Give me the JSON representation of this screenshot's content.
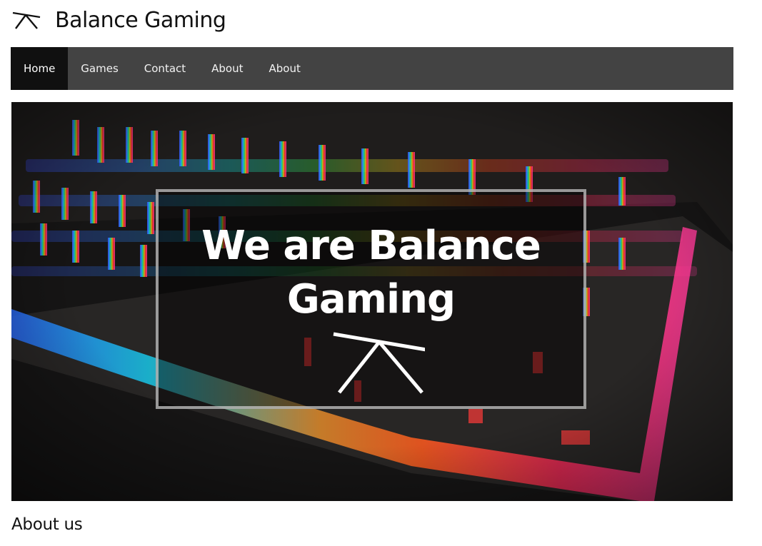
{
  "header": {
    "logo_icon": "balance-scale-icon",
    "title": "Balance Gaming"
  },
  "nav": {
    "items": [
      {
        "label": "Home",
        "active": true
      },
      {
        "label": "Games",
        "active": false
      },
      {
        "label": "Contact",
        "active": false
      },
      {
        "label": "About",
        "active": false
      },
      {
        "label": "About",
        "active": false
      }
    ]
  },
  "hero": {
    "title_line1": "We are Balance",
    "title_line2": "Gaming",
    "emblem_icon": "balance-scale-icon",
    "background": "rgb-keyboard-photo"
  },
  "about": {
    "heading": "About us"
  },
  "colors": {
    "nav_bg": "#434343",
    "nav_active_bg": "#101010",
    "hero_text": "#ffffff"
  }
}
